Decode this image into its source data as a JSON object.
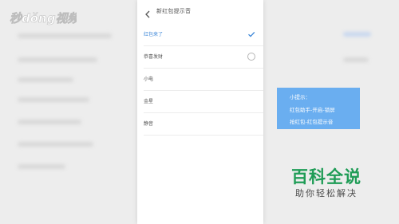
{
  "logo": {
    "text": "秒懂视频"
  },
  "screen": {
    "title": "新红包提示音",
    "options": [
      {
        "label": "红包来了",
        "selected": true
      },
      {
        "label": "恭喜发财",
        "selected": false
      },
      {
        "label": "小电",
        "selected": false
      },
      {
        "label": "金星",
        "selected": false
      },
      {
        "label": "静音",
        "selected": false
      }
    ]
  },
  "tip": {
    "line1": "小提示：",
    "line2": "红包助手-开启-锁屏",
    "line3": "抢红包-红包提示音"
  },
  "brand": {
    "main": "百科全说",
    "sub": "助你轻松解决"
  },
  "colors": {
    "accent": "#3b86d8",
    "tip_bg": "#6aaef0",
    "brand_green": "#1f9c56"
  }
}
